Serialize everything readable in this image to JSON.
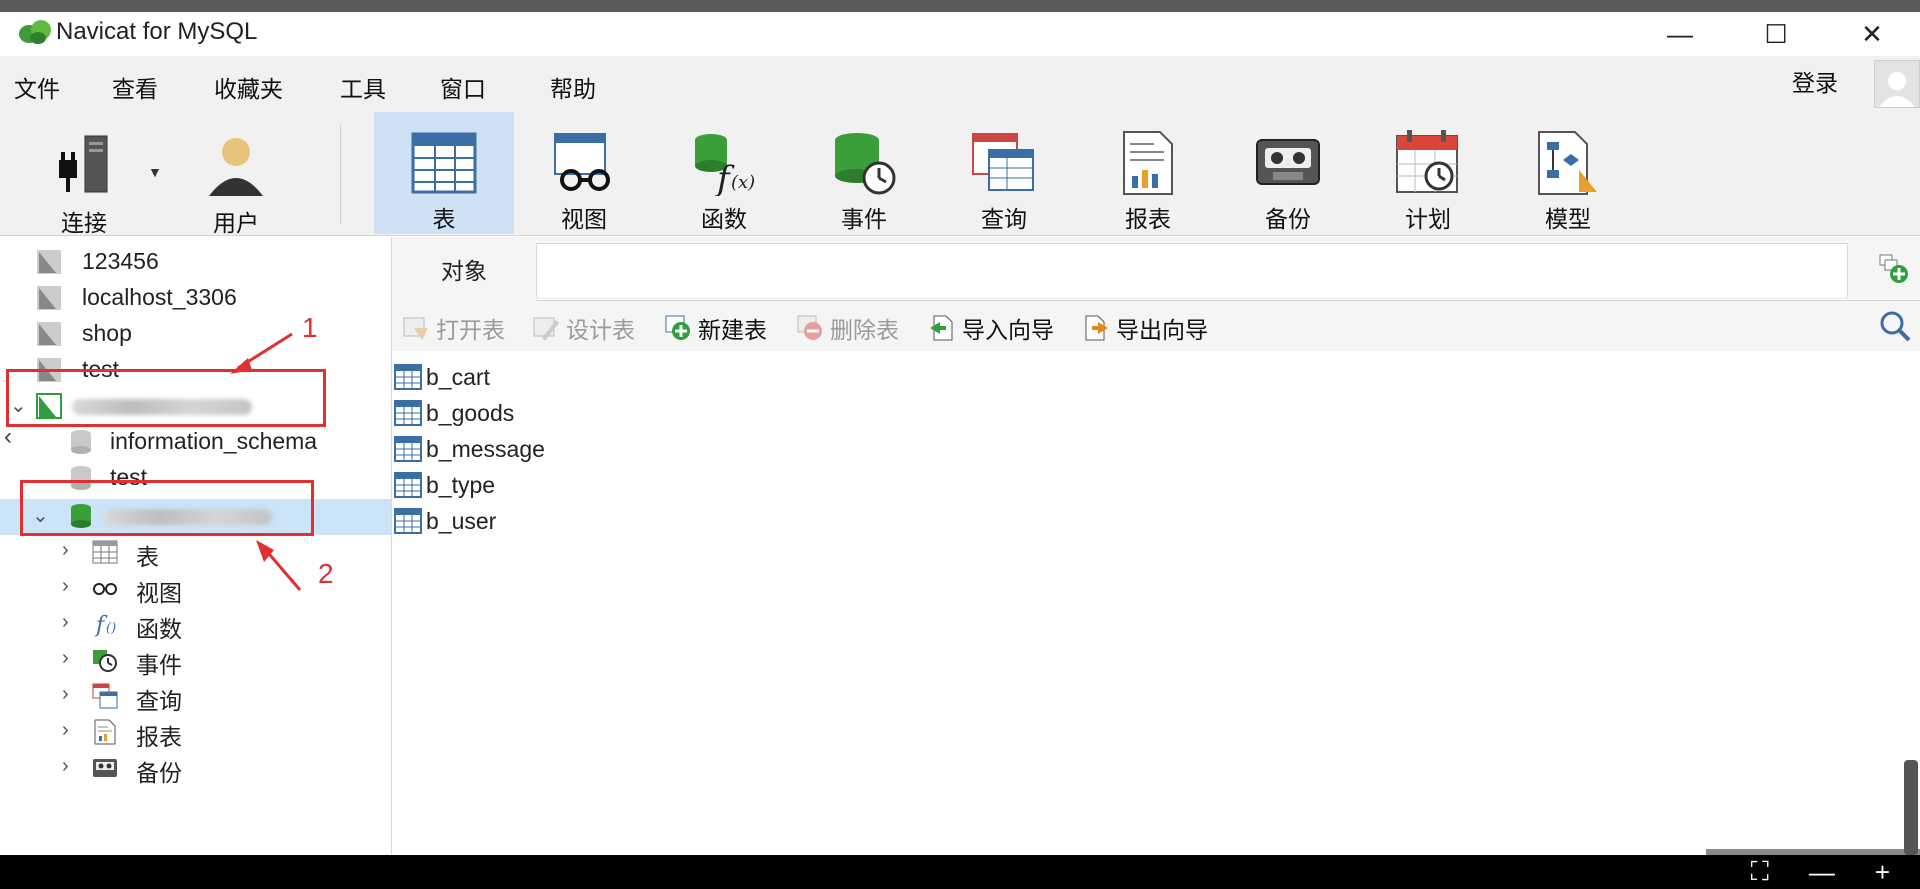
{
  "window": {
    "title": "Navicat for MySQL",
    "minimize": "—",
    "maximize": "☐",
    "close": "✕"
  },
  "menu": [
    "文件",
    "查看",
    "收藏夹",
    "工具",
    "窗口",
    "帮助"
  ],
  "login_label": "登录",
  "toolbar": {
    "connect": "连接",
    "user": "用户",
    "table": "表",
    "view": "视图",
    "function": "函数",
    "event": "事件",
    "query": "查询",
    "report": "报表",
    "backup": "备份",
    "schedule": "计划",
    "model": "模型"
  },
  "tree": {
    "connections": [
      "123456",
      "localhost_3306",
      "shop",
      "test"
    ],
    "databases": [
      "information_schema",
      "test"
    ],
    "children": [
      "表",
      "视图",
      "函数",
      "事件",
      "查询",
      "报表",
      "备份"
    ]
  },
  "annotations": [
    "1",
    "2"
  ],
  "tab": {
    "objects": "对象"
  },
  "objbar": {
    "open_table": "打开表",
    "design_table": "设计表",
    "new_table": "新建表",
    "delete_table": "删除表",
    "import_wizard": "导入向导",
    "export_wizard": "导出向导"
  },
  "tables": [
    "b_cart",
    "b_goods",
    "b_message",
    "b_type",
    "b_user"
  ],
  "colors": {
    "selected_row": "#cce4f7",
    "active_tool": "#cfe2f5",
    "annotation_red": "#e03030",
    "db_green": "#2e9e3e"
  }
}
